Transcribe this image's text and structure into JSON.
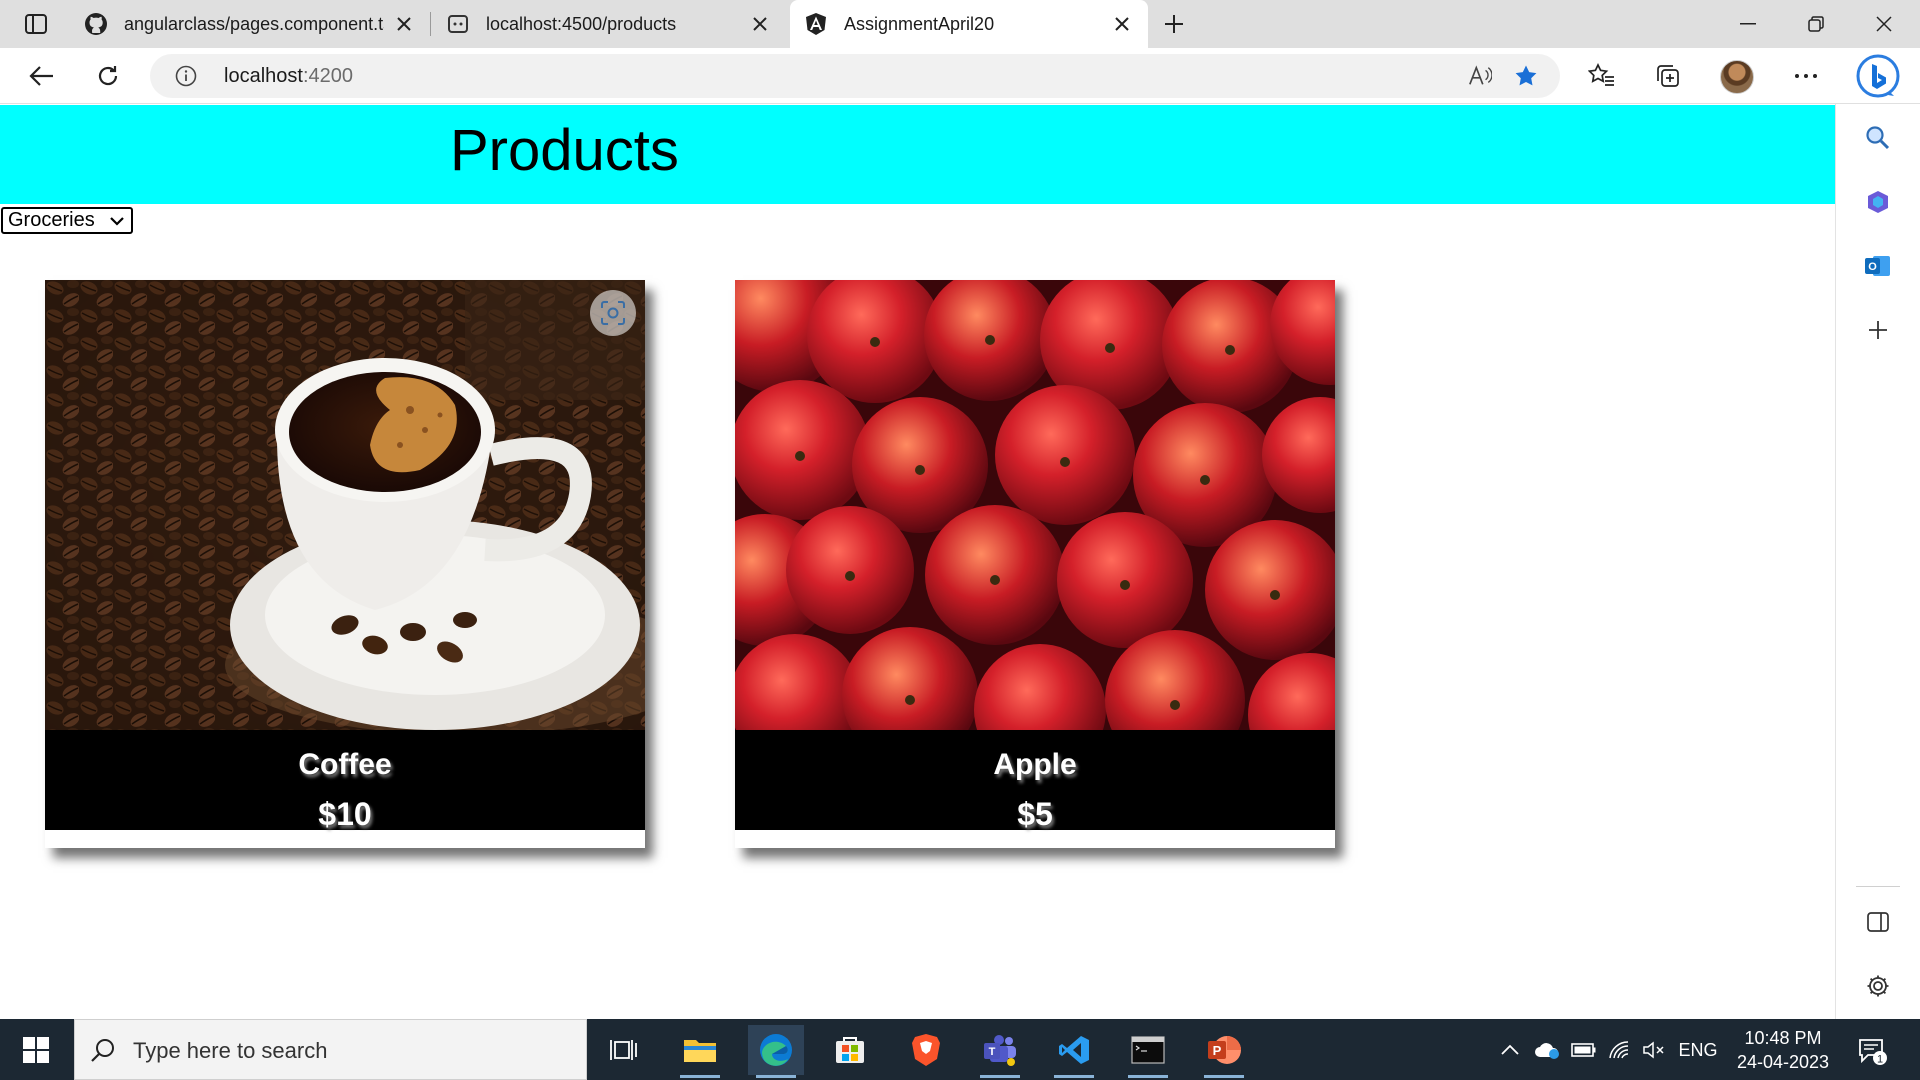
{
  "browser": {
    "tabs": [
      {
        "title": "angularclass/pages.component.ts",
        "favicon": "github-icon"
      },
      {
        "title": "localhost:4500/products",
        "favicon": "page-icon"
      },
      {
        "title": "AssignmentApril20",
        "favicon": "angular-icon",
        "active": true
      }
    ],
    "address": {
      "host": "localhost",
      "port": ":4200"
    }
  },
  "page": {
    "title": "Products",
    "category": {
      "selected": "Groceries"
    },
    "products": [
      {
        "name": "Coffee",
        "price": "$10",
        "image": "coffee-cup-with-beans"
      },
      {
        "name": "Apple",
        "price": "$5",
        "image": "red-apples"
      }
    ]
  },
  "taskbar": {
    "search_placeholder": "Type here to search",
    "language": "ENG",
    "time": "10:48 PM",
    "date": "24-04-2023",
    "notifications": "1"
  },
  "colors": {
    "header_bg": "#00ffff",
    "caption_bg": "#000000",
    "taskbar_bg": "#1c2833"
  }
}
